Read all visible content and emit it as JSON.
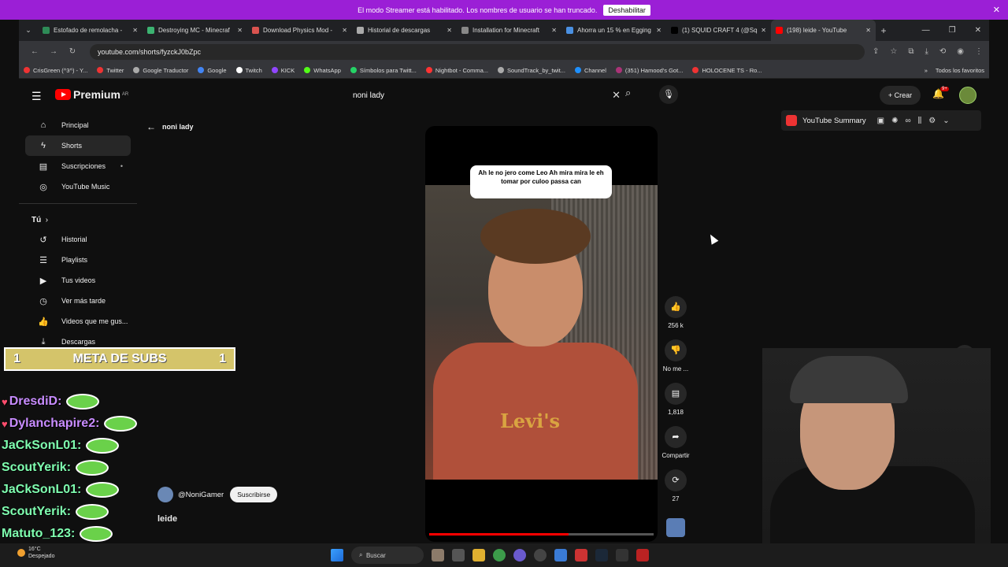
{
  "banner": {
    "text": "El modo Streamer está habilitado. Los nombres de usuario se han truncado.",
    "button": "Deshabilitar"
  },
  "tabs": [
    {
      "label": "Estofado de remolacha - ",
      "color": "#2e8b57"
    },
    {
      "label": "Destroying MC - Minecraf",
      "color": "#3cb371"
    },
    {
      "label": "Download Physics Mod - ",
      "color": "#d9534f"
    },
    {
      "label": "Historial de descargas",
      "color": "#aaaaaa"
    },
    {
      "label": "Installation for Minecraft",
      "color": "#888888"
    },
    {
      "label": "Ahorra un 15 % en Egging",
      "color": "#4a90e2"
    },
    {
      "label": "(1) SQUID CRAFT 4 (@Squ",
      "color": "#000000"
    },
    {
      "label": "(198) leide - YouTube",
      "color": "#ff0000"
    }
  ],
  "address": {
    "url": "youtube.com/shorts/fyzckJ0bZpc"
  },
  "bookmarks": [
    "CrisGreen (^3^) - Y...",
    "Twitter",
    "Google Traductor",
    "Google",
    "Twitch",
    "KICK",
    "WhatsApp",
    "Símbolos para Twitt...",
    "Nightbot - Comma...",
    "SoundTrack_by_twit...",
    "Channel",
    "(351) Hamood's Got...",
    "HOLOCENE TS - Ro..."
  ],
  "bookmarks_all": "Todos los favoritos",
  "yt": {
    "logo": "Premium",
    "logo_sup": "AR",
    "search_value": "noni lady",
    "create": "Crear",
    "notif_badge": "9+",
    "summary": "YouTube Summary",
    "back_label": "noni lady"
  },
  "sidebar": {
    "top": [
      "Principal",
      "Shorts",
      "Suscripciones",
      "YouTube Music"
    ],
    "you_header": "Tú",
    "you": [
      "Historial",
      "Playlists",
      "Tus videos",
      "Ver más tarde",
      "Videos que me gus...",
      "Descargas"
    ]
  },
  "short": {
    "caption": "Ah le no jero come Leo Ah mira mira le eh tomar por culoo passa can",
    "shirt_brand": "Levi's",
    "likes": "256 k",
    "dislike": "No me ...",
    "comments": "1,818",
    "share": "Compartir",
    "remix": "27",
    "channel": "@NoniGamer",
    "subscribe": "Suscribirse",
    "title": "leide",
    "progress": 0.62
  },
  "overlay": {
    "meta_left": "1",
    "meta_label": "META DE SUBS",
    "meta_right": "1",
    "chat": [
      "DresdiD:",
      "Dylanchapire2:",
      "JaCkSonL01:",
      "ScoutYerik:",
      "JaCkSonL01:",
      "ScoutYerik:",
      "Matuto_123:"
    ]
  },
  "taskbar": {
    "temp": "16°C",
    "weather": "Despejado",
    "search": "Buscar"
  }
}
